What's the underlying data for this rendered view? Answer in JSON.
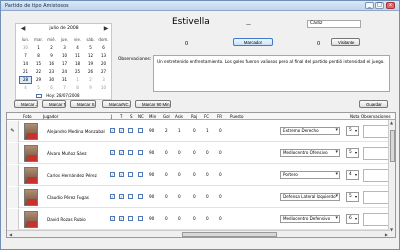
{
  "window": {
    "title": "Partido de tipo Amistosos",
    "controls": [
      "_",
      "□",
      "x"
    ]
  },
  "calendar": {
    "month": "julio de 2008",
    "prev": "◀",
    "next": "▶",
    "weekdays": [
      "lun.",
      "mar.",
      "mié.",
      "jue.",
      "vie.",
      "sáb.",
      "dom."
    ],
    "days": [
      [
        "30",
        "1",
        "2",
        "3",
        "4",
        "5",
        "6"
      ],
      [
        "7",
        "8",
        "9",
        "10",
        "11",
        "12",
        "13"
      ],
      [
        "14",
        "15",
        "16",
        "17",
        "18",
        "19",
        "20"
      ],
      [
        "21",
        "22",
        "23",
        "24",
        "25",
        "26",
        "27"
      ],
      [
        "28",
        "29",
        "30",
        "31",
        "1",
        "2",
        "3"
      ],
      [
        "4",
        "5",
        "6",
        "7",
        "8",
        "9",
        "10"
      ]
    ],
    "selected": "28",
    "today": "Hoy: 28/07/2008"
  },
  "match": {
    "home_team": "Estivella",
    "separator": "—",
    "away_team": "Cádiz",
    "home_score": "0",
    "away_score": "0",
    "home_button": "Marcador",
    "away_button": "Visitante"
  },
  "observations": {
    "label": "Observaciones:",
    "text": "Un entretenido enfrentamiento. Los goles fueron valiosos pero al final del partido perdió intensidad el juego."
  },
  "toolbar": {
    "buttons": [
      "Marcar J.",
      "Marcar T.",
      "Marcar S.",
      "MarcarNC.",
      "Marcar 90 Min"
    ],
    "save": "Guardar"
  },
  "table": {
    "headers": [
      "Foto",
      "Jugador",
      "J",
      "T",
      "S",
      "NC",
      "Min",
      "Gol",
      "Asis",
      "Roj",
      "FC",
      "FR",
      "Puesto",
      "Nota",
      "Observaciones"
    ],
    "rows": [
      {
        "name": "Alejandro Medina Monzabal",
        "checks": [
          true,
          true,
          false,
          false
        ],
        "min": "90",
        "gol": "2",
        "asis": "1",
        "roj": "0",
        "fc": "1",
        "fr": "0",
        "position": "Extremo Derecho",
        "nota": "5"
      },
      {
        "name": "Álvaro Muñoz Sáez",
        "checks": [
          true,
          true,
          false,
          false
        ],
        "min": "90",
        "gol": "0",
        "asis": "0",
        "roj": "0",
        "fc": "0",
        "fr": "0",
        "position": "Mediocentro Ofensivo",
        "nota": "5"
      },
      {
        "name": "Carlos Hernández Pérez",
        "checks": [
          true,
          true,
          false,
          false
        ],
        "min": "90",
        "gol": "0",
        "asis": "0",
        "roj": "0",
        "fc": "0",
        "fr": "0",
        "position": "Portero",
        "nota": "4"
      },
      {
        "name": "Claudio Pérez Fugas",
        "checks": [
          true,
          true,
          false,
          false
        ],
        "min": "90",
        "gol": "0",
        "asis": "0",
        "roj": "0",
        "fc": "0",
        "fr": "0",
        "position": "Defensa Lateral Izquierdo",
        "nota": "5"
      },
      {
        "name": "David Rozas Rubio",
        "checks": [
          true,
          true,
          false,
          false
        ],
        "min": "90",
        "gol": "0",
        "asis": "0",
        "roj": "0",
        "fc": "0",
        "fr": "0",
        "position": "Mediocentro Defensivo",
        "nota": "6"
      }
    ]
  },
  "scrollbar": {
    "up": "▲",
    "down": "▼",
    "left": "◀",
    "right": "▶"
  }
}
